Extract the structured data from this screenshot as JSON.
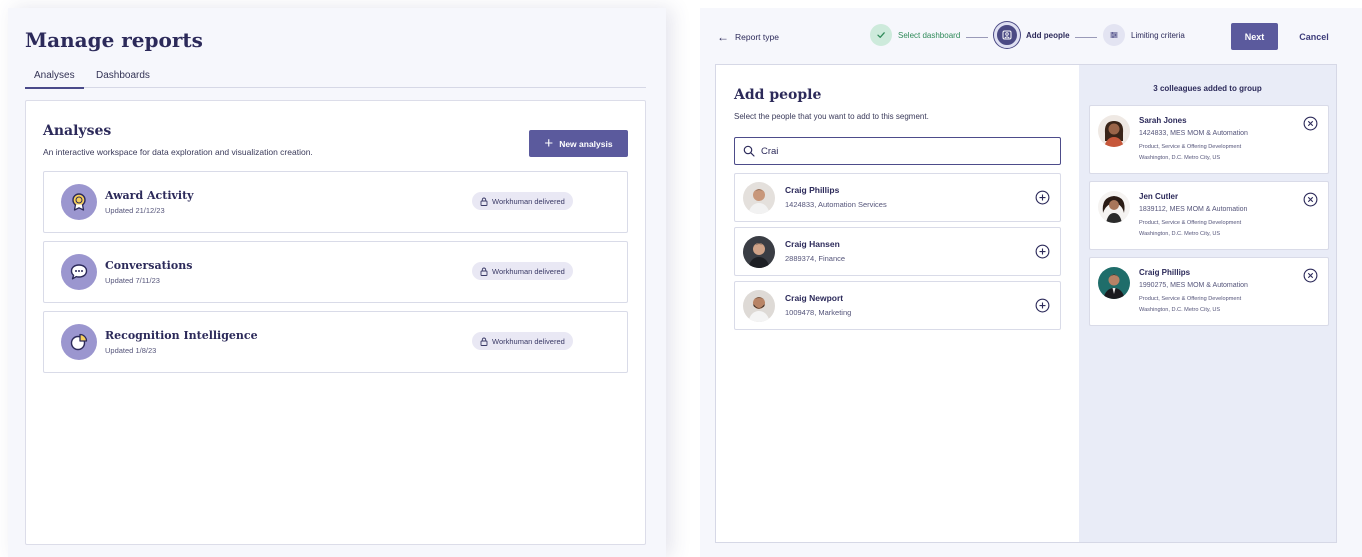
{
  "manage": {
    "title": "Manage reports",
    "tabs": [
      {
        "label": "Analyses"
      },
      {
        "label": "Dashboards"
      }
    ],
    "section": {
      "title": "Analyses",
      "subtitle": "An interactive workspace for data exploration and visualization creation.",
      "new_button": "New analysis"
    },
    "analyses": [
      {
        "name": "Award Activity",
        "updated": "Updated 21/12/23",
        "badge": "Workhuman delivered",
        "icon": "award-icon"
      },
      {
        "name": "Conversations",
        "updated": "Updated 7/11/23",
        "badge": "Workhuman delivered",
        "icon": "chat-bubble-icon"
      },
      {
        "name": "Recognition Intelligence",
        "updated": "Updated 1/8/23",
        "badge": "Workhuman delivered",
        "icon": "pie-chart-icon"
      }
    ]
  },
  "wizard": {
    "back_label": "Report type",
    "steps": [
      {
        "label": "Select dashboard",
        "state": "done",
        "icon": "check-icon"
      },
      {
        "label": "Add people",
        "state": "current",
        "icon": "people-icon"
      },
      {
        "label": "Limiting criteria",
        "state": "upcoming",
        "icon": "filter-icon"
      }
    ],
    "next_label": "Next",
    "cancel_label": "Cancel",
    "add_people": {
      "title": "Add people",
      "subtitle": "Select the people that you want to add to this segment.",
      "search_value": "Crai",
      "results": [
        {
          "name": "Craig Phillips",
          "meta": "1424833, Automation Services"
        },
        {
          "name": "Craig Hansen",
          "meta": "2889374, Finance"
        },
        {
          "name": "Craig Newport",
          "meta": "1009478, Marketing"
        }
      ]
    },
    "group": {
      "heading": "3 colleagues added to group",
      "members": [
        {
          "name": "Sarah Jones",
          "id_line": "1424833, MES MOM & Automation",
          "dept": "Product, Service & Offering Development",
          "location": "Washington, D.C. Metro City, US"
        },
        {
          "name": "Jen Cutler",
          "id_line": "1839112, MES MOM & Automation",
          "dept": "Product, Service & Offering Development",
          "location": "Washington, D.C. Metro City, US"
        },
        {
          "name": "Craig Phillips",
          "id_line": "1990275, MES MOM & Automation",
          "dept": "Product, Service & Offering Development",
          "location": "Washington, D.C. Metro City, US"
        }
      ]
    }
  },
  "colors": {
    "accent": "#5b5a9d",
    "icon_bg": "#9b96cf",
    "success_bg": "#cdeadb",
    "success_text": "#2f8a59"
  }
}
